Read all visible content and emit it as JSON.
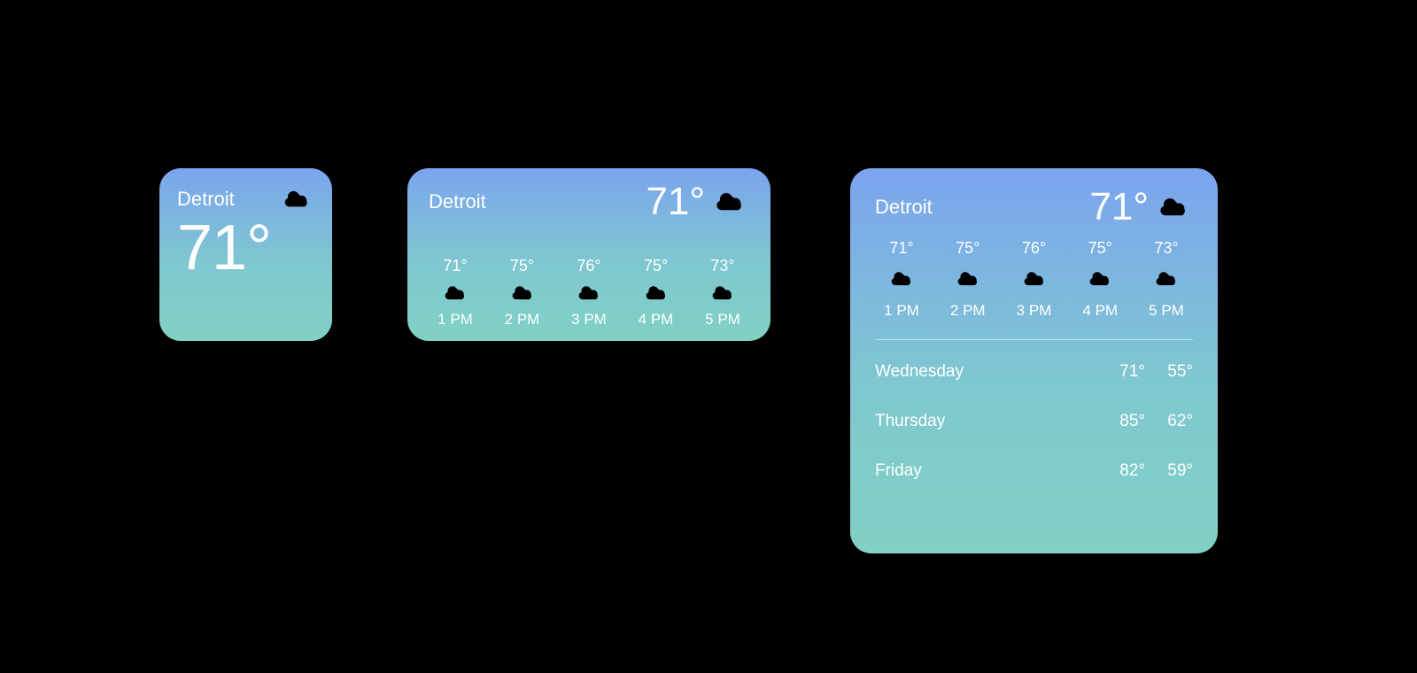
{
  "location": "Detroit",
  "current_temp": "71°",
  "condition_icon": "sun-cloud-icon",
  "hourly": [
    {
      "temp": "71°",
      "time": "1 PM",
      "icon": "sun-cloud-icon"
    },
    {
      "temp": "75°",
      "time": "2 PM",
      "icon": "sun-cloud-icon"
    },
    {
      "temp": "76°",
      "time": "3 PM",
      "icon": "sun-cloud-icon"
    },
    {
      "temp": "75°",
      "time": "4 PM",
      "icon": "sun-cloud-icon"
    },
    {
      "temp": "73°",
      "time": "5 PM",
      "icon": "sun-cloud-icon"
    }
  ],
  "daily": [
    {
      "name": "Wednesday",
      "hi": "71°",
      "lo": "55°"
    },
    {
      "name": "Thursday",
      "hi": "85°",
      "lo": "62°"
    },
    {
      "name": "Friday",
      "hi": "82°",
      "lo": "59°"
    }
  ]
}
